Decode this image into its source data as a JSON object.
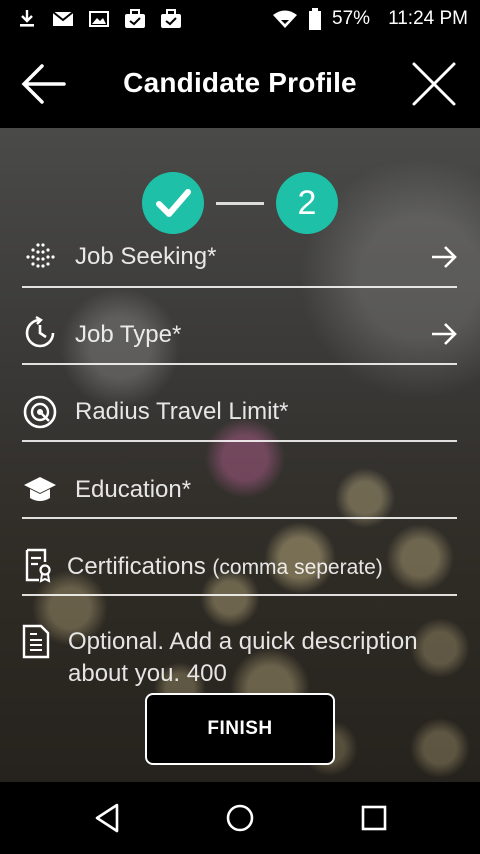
{
  "status_bar": {
    "battery": "57%",
    "time": "11:24 PM",
    "icons": [
      "download-icon",
      "mail-icon",
      "image-icon",
      "briefcase-check-icon",
      "briefcase-check-icon",
      "wifi-icon",
      "battery-icon"
    ]
  },
  "header": {
    "title": "Candidate Profile",
    "back_icon": "arrow-left-icon",
    "close_icon": "close-icon"
  },
  "stepper": {
    "step1_state": "completed",
    "step2_label": "2",
    "accent": "#1ec1a8"
  },
  "form": {
    "job_seeking": "Job Seeking*",
    "job_type": "Job Type*",
    "radius": "Radius Travel Limit*",
    "education": "Education*",
    "certifications_main": "Certifications",
    "certifications_hint": "(comma seperate)",
    "description_placeholder": "Optional. Add a quick description about you. 400"
  },
  "finish_label": "FINISH",
  "nav": [
    "back-icon",
    "home-icon",
    "recents-icon"
  ]
}
